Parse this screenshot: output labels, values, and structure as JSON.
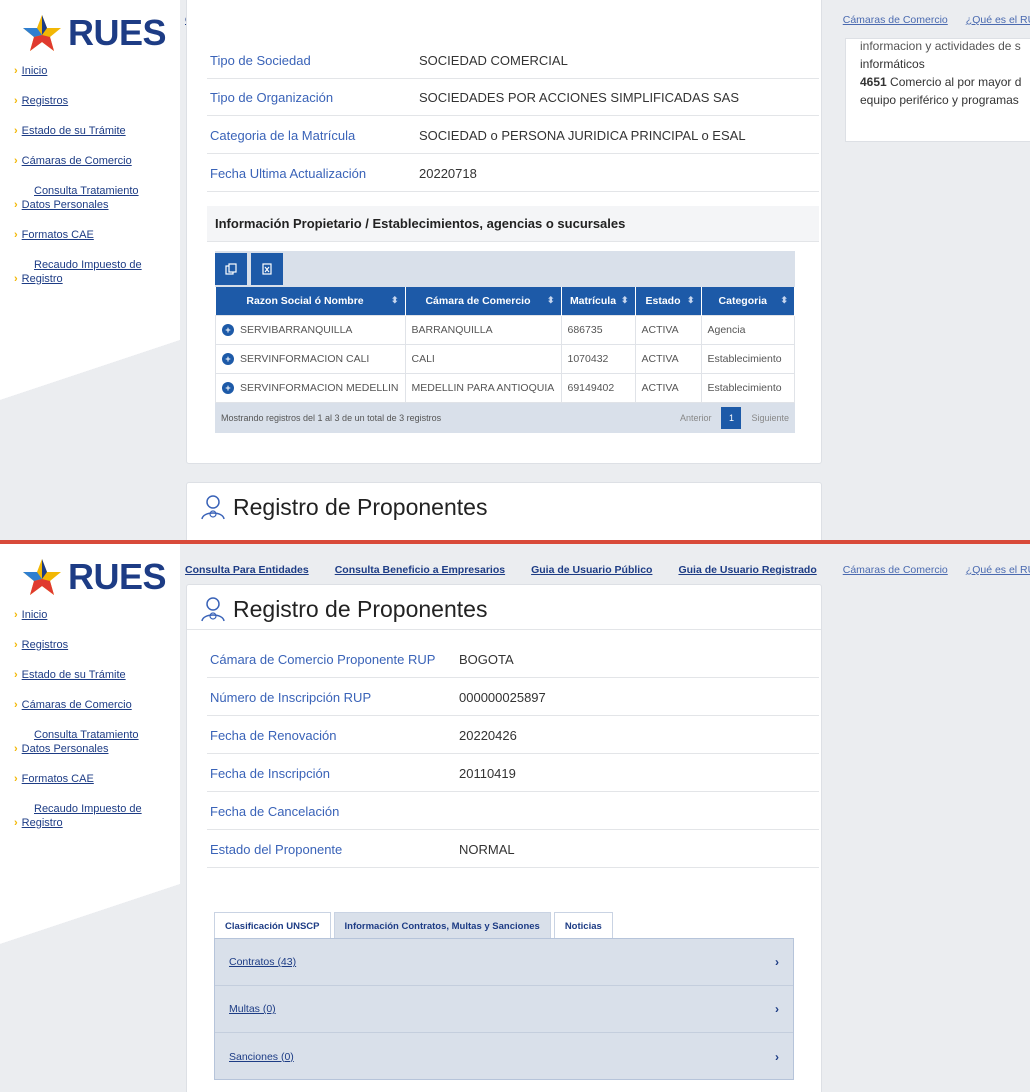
{
  "app": {
    "logo_text": "RUES"
  },
  "sidebar": {
    "items": [
      {
        "label": "Inicio"
      },
      {
        "label": "Registros"
      },
      {
        "label": "Estado de su Trámite"
      },
      {
        "label": "Cámaras de Comercio"
      },
      {
        "label_line1": "Consulta Tratamiento",
        "label_line2": "Datos Personales"
      },
      {
        "label": "Formatos CAE"
      },
      {
        "label_line1": "Recaudo Impuesto de",
        "label_line2": "Registro"
      }
    ]
  },
  "topnav": {
    "items": [
      "Consulta Para Entidades",
      "Consulta Beneficio a Empresarios",
      "Guia de Usuario Público",
      "Guia de Usuario Registrado",
      "Cámaras de Comercio",
      "¿Qué es el RUES?"
    ]
  },
  "right_card": {
    "line0": "informacion y actividades de s",
    "line1": "informáticos",
    "line2_code": "4651",
    "line2_text": " Comercio al por mayor d",
    "line3": "equipo periférico y programas"
  },
  "company_info": {
    "rows": [
      {
        "label": "Tipo de Sociedad",
        "value": "SOCIEDAD COMERCIAL"
      },
      {
        "label": "Tipo de Organización",
        "value": "SOCIEDADES POR ACCIONES SIMPLIFICADAS SAS"
      },
      {
        "label": "Categoria de la Matrícula",
        "value": "SOCIEDAD o PERSONA JURIDICA PRINCIPAL o ESAL"
      },
      {
        "label": "Fecha Ultima Actualización",
        "value": "20220718"
      }
    ]
  },
  "establishments": {
    "title": "Información Propietario / Establecimientos, agencias o sucursales",
    "columns": [
      "Razon Social ó Nombre",
      "Cámara de Comercio",
      "Matrícula",
      "Estado",
      "Categoria"
    ],
    "rows": [
      [
        "SERVIBARRANQUILLA",
        "BARRANQUILLA",
        "686735",
        "ACTIVA",
        "Agencia"
      ],
      [
        "SERVINFORMACION CALI",
        "CALI",
        "1070432",
        "ACTIVA",
        "Establecimiento"
      ],
      [
        "SERVINFORMACION MEDELLIN",
        "MEDELLIN PARA ANTIOQUIA",
        "69149402",
        "ACTIVA",
        "Establecimiento"
      ]
    ],
    "footer_info": "Mostrando registros del 1 al 3 de un total de 3 registros",
    "prev": "Anterior",
    "page": "1",
    "next": "Siguiente"
  },
  "proponentes": {
    "title": "Registro de Proponentes",
    "rows": [
      {
        "label": "Cámara de Comercio Proponente RUP",
        "value": "BOGOTA"
      },
      {
        "label": "Número de Inscripción RUP",
        "value": "000000025897"
      },
      {
        "label": "Fecha de Renovación",
        "value": "20220426"
      },
      {
        "label": "Fecha de Inscripción",
        "value": "20110419"
      },
      {
        "label": "Fecha de Cancelación",
        "value": ""
      },
      {
        "label": "Estado del Proponente",
        "value": "NORMAL"
      }
    ],
    "tabs": [
      "Clasificación UNSCP",
      "Información Contratos, Multas y Sanciones",
      "Noticias"
    ],
    "panel_items": [
      "Contratos (43)",
      "Multas (0)",
      "Sanciones (0)"
    ]
  },
  "colors": {
    "brand_blue": "#1d3c85",
    "accent_yellow": "#f2b705",
    "table_header": "#1d5aa8",
    "divider_red": "#d84a3a"
  },
  "icons": [
    "copy-icon",
    "excel-icon",
    "sort-icon",
    "plus-circle-icon",
    "user-award-icon",
    "chevron-right-icon"
  ]
}
